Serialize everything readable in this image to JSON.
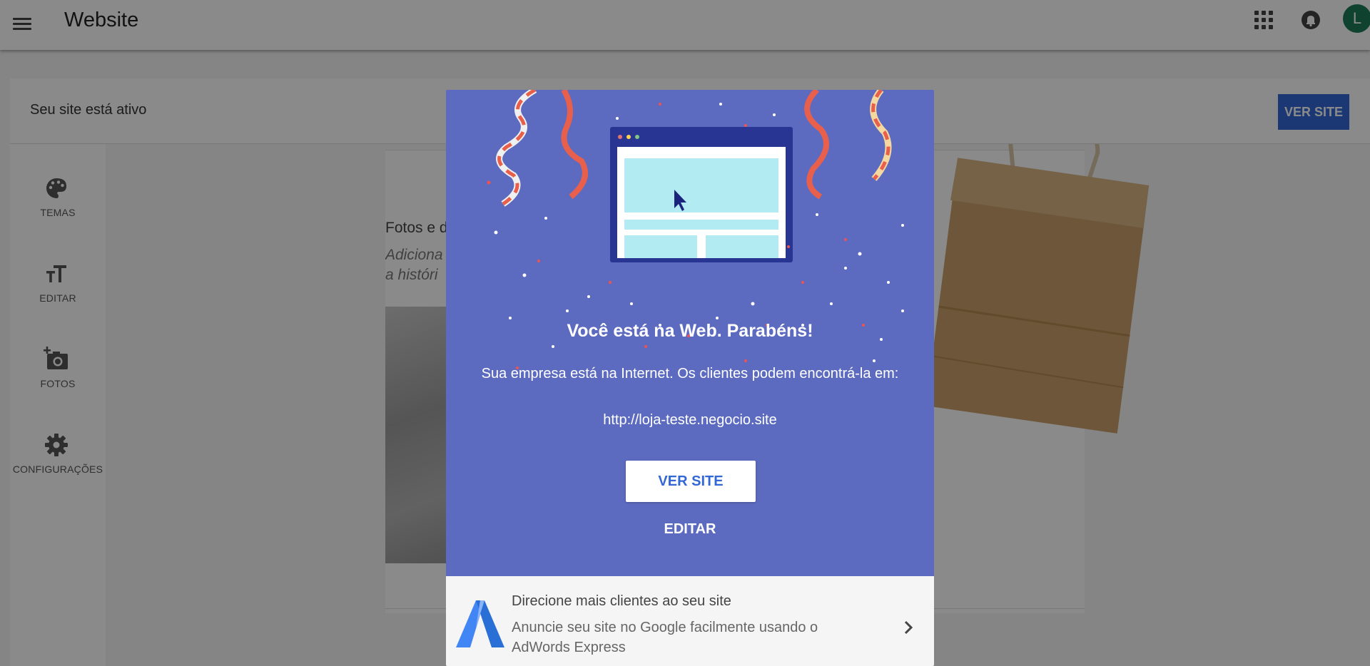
{
  "appbar": {
    "title": "Website",
    "avatar_initial": "L"
  },
  "statusbar": {
    "text": "Seu site está ativo",
    "ver_site_label": "VER SITE"
  },
  "sidebar": {
    "items": [
      {
        "label": "TEMAS",
        "icon": "palette-icon"
      },
      {
        "label": "EDITAR",
        "icon": "text-format-icon"
      },
      {
        "label": "FOTOS",
        "icon": "add-photo-icon"
      },
      {
        "label": "CONFIGURAÇÕES",
        "icon": "gear-icon"
      }
    ]
  },
  "background": {
    "heading": "Fotos e d",
    "subtitle_line1": "Adiciona",
    "subtitle_line2": "a históri"
  },
  "dialog": {
    "title": "Você está na Web. Parabéns!",
    "body": "Sua empresa está na Internet. Os clientes podem encontrá-la em:",
    "url": "http://loja-teste.negocio.site",
    "primary_label": "VER SITE",
    "secondary_label": "EDITAR",
    "promo": {
      "title": "Direcione mais clientes ao seu site",
      "description": "Anuncie seu site no Google facilmente usando o AdWords Express"
    }
  },
  "colors": {
    "dialog_hero": "#5c6bc0",
    "primary_blue": "#3367d6",
    "avatar": "#1e7a5a"
  }
}
